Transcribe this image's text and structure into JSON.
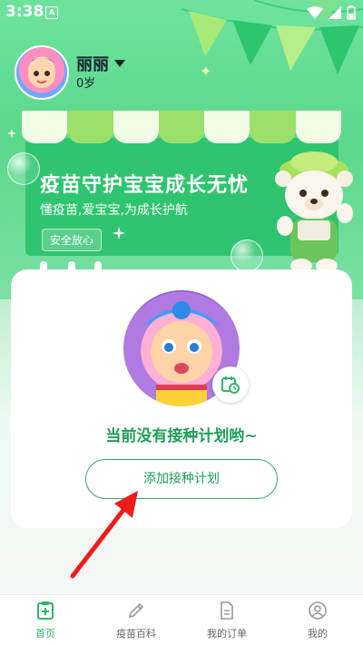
{
  "status_bar": {
    "time": "3:38",
    "notif_letter": "A"
  },
  "profile": {
    "name": "丽丽",
    "age": "0岁"
  },
  "banner": {
    "title": "疫苗守护宝宝成长无忧",
    "subtitle": "懂疫苗,爱宝宝,为成长护航",
    "badge": "安全放心"
  },
  "plan": {
    "empty_text": "当前没有接种计划哟~",
    "add_button": "添加接种计划"
  },
  "nav": {
    "items": [
      {
        "label": "首页",
        "icon": "home-plus-icon",
        "active": true
      },
      {
        "label": "疫苗百科",
        "icon": "pencil-icon",
        "active": false
      },
      {
        "label": "我的订单",
        "icon": "document-icon",
        "active": false
      },
      {
        "label": "我的",
        "icon": "user-icon",
        "active": false
      }
    ]
  },
  "colors": {
    "accent": "#2fb36a",
    "banner": "#2fc46f",
    "text_green": "#1f9e57"
  }
}
